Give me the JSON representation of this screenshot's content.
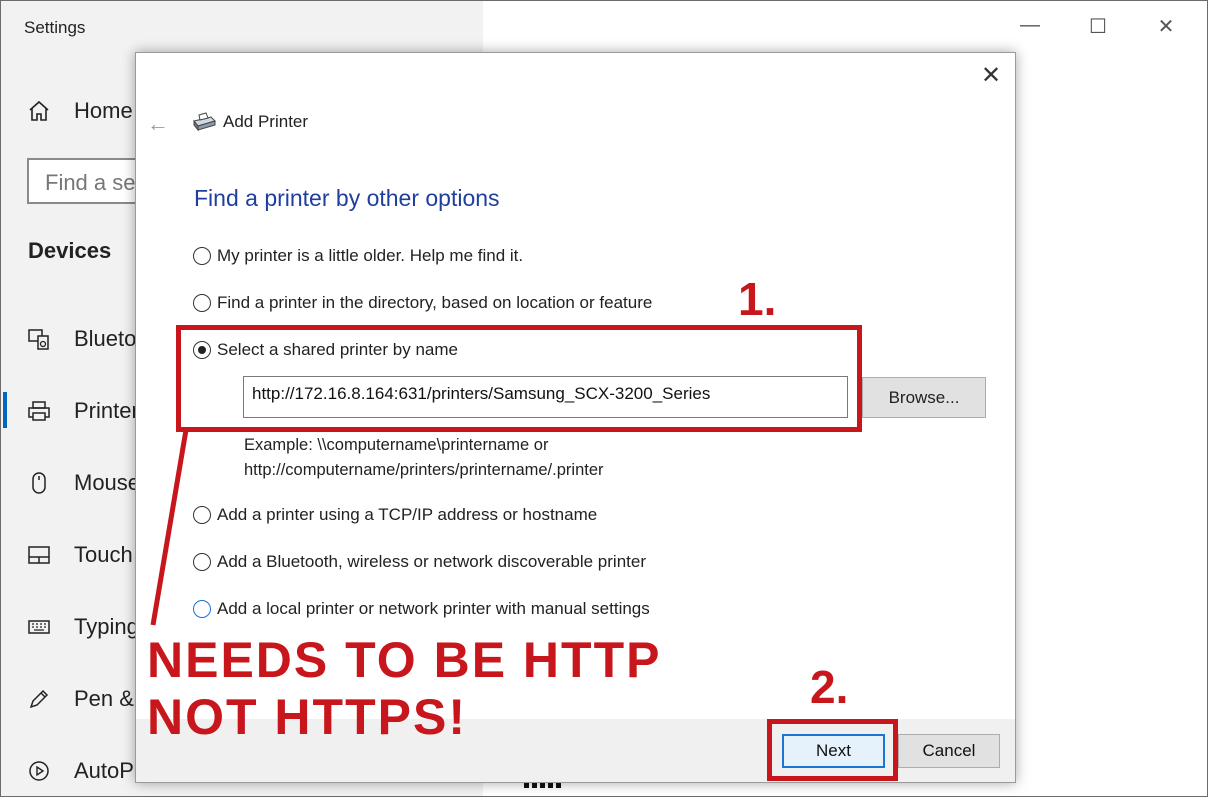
{
  "window": {
    "title": "Settings",
    "minimize": "—",
    "maximize": "☐",
    "close": "✕"
  },
  "sidebar": {
    "home_label": "Home",
    "search_placeholder": "Find a se",
    "section_heading": "Devices",
    "items": [
      {
        "label": "Blueto",
        "icon": "bluetooth-devices-icon"
      },
      {
        "label": "Printer",
        "icon": "printer-icon"
      },
      {
        "label": "Mouse",
        "icon": "mouse-icon"
      },
      {
        "label": "Touch",
        "icon": "touchpad-icon"
      },
      {
        "label": "Typing",
        "icon": "keyboard-icon"
      },
      {
        "label": "Pen &",
        "icon": "pen-icon"
      },
      {
        "label": "AutoP",
        "icon": "autoplay-icon"
      }
    ]
  },
  "dialog": {
    "close": "✕",
    "title": "Add Printer",
    "heading": "Find a printer by other options",
    "options": [
      {
        "label": "My printer is a little older. Help me find it.",
        "selected": false
      },
      {
        "label": "Find a printer in the directory, based on location or feature",
        "selected": false
      },
      {
        "label": "Select a shared printer by name",
        "selected": true
      },
      {
        "label": "Add a printer using a TCP/IP address or hostname",
        "selected": false
      },
      {
        "label": "Add a Bluetooth, wireless or network discoverable printer",
        "selected": false
      },
      {
        "label": "Add a local printer or network printer with manual settings",
        "selected": false
      }
    ],
    "url_value": "http://172.16.8.164:631/printers/Samsung_SCX-3200_Series",
    "browse_label": "Browse...",
    "example_line1": "Example: \\\\computername\\printername or",
    "example_line2": "http://computername/printers/printername/.printer",
    "next_label": "Next",
    "cancel_label": "Cancel"
  },
  "annotations": {
    "step1": "1.",
    "step2": "2.",
    "warning_line1": "NEEDS TO BE HTTP",
    "warning_line2": "NOT HTTPS!",
    "color": "#c8161d"
  }
}
